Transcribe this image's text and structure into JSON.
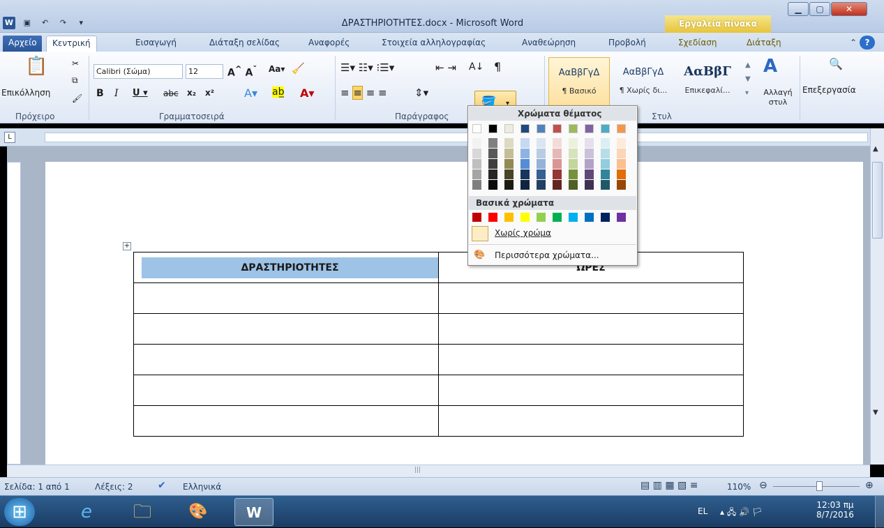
{
  "window": {
    "title": "ΔΡΑΣΤΗΡΙΟΤΗΤΕΣ.docx - Microsoft Word",
    "table_tools": "Εργαλεία πίνακα"
  },
  "tabs": [
    "Αρχείο",
    "Κεντρική",
    "Εισαγωγή",
    "Διάταξη σελίδας",
    "Αναφορές",
    "Στοιχεία αλληλογραφίας",
    "Αναθεώρηση",
    "Προβολή",
    "Σχεδίαση",
    "Διάταξη"
  ],
  "ribbon": {
    "paste_label": "Επικόλληση",
    "font_name": "Calibri (Σώμα)",
    "font_size": "12",
    "style1_sample": "ΑαΒβΓγΔ",
    "style1_label": "¶ Βασικό",
    "style2_sample": "ΑαΒβΓγΔ",
    "style2_label": "¶ Χωρίς δι...",
    "style3_sample": "ΑαΒβΓ",
    "style3_label": "Επικεφαλί...",
    "change_styles": "Αλλαγή στυλ",
    "editing": "Επεξεργασία",
    "groups": {
      "clipboard": "Πρόχειρο",
      "font": "Γραμματοσειρά",
      "paragraph": "Παράγραφος",
      "styles": "Στυλ"
    }
  },
  "popup": {
    "theme_colors": "Χρώματα θέματος",
    "standard_colors": "Βασικά χρώματα",
    "no_color": "Χωρίς χρώμα",
    "more_colors": "Περισσότερα χρώματα...",
    "theme_row": [
      "#ffffff",
      "#000000",
      "#eeece1",
      "#1f497d",
      "#4f81bd",
      "#c0504d",
      "#9bbb59",
      "#8064a2",
      "#4bacc6",
      "#f79646"
    ],
    "theme_shades": [
      [
        "#f2f2f2",
        "#7f7f7f",
        "#ddd9c3",
        "#c6d9f0",
        "#dbe5f1",
        "#f2dcdb",
        "#ebf1dd",
        "#e5e0ec",
        "#dbeef3",
        "#fdeada"
      ],
      [
        "#d8d8d8",
        "#595959",
        "#c4bd97",
        "#8db3e2",
        "#b8cce4",
        "#e5b9b7",
        "#d7e3bc",
        "#ccc1d9",
        "#b7dde8",
        "#fbd5b5"
      ],
      [
        "#bfbfbf",
        "#3f3f3f",
        "#938953",
        "#548dd4",
        "#95b3d7",
        "#d99694",
        "#c3d69b",
        "#b2a2c7",
        "#92cddc",
        "#fac08f"
      ],
      [
        "#a5a5a5",
        "#262626",
        "#494429",
        "#17365d",
        "#366092",
        "#953734",
        "#76923c",
        "#5f497a",
        "#31859b",
        "#e36c09"
      ],
      [
        "#7f7f7f",
        "#0c0c0c",
        "#1d1b10",
        "#0f243e",
        "#244061",
        "#632423",
        "#4f6128",
        "#3f3151",
        "#205867",
        "#974806"
      ]
    ],
    "standard_row": [
      "#c00000",
      "#ff0000",
      "#ffc000",
      "#ffff00",
      "#92d050",
      "#00b050",
      "#00b0f0",
      "#0070c0",
      "#002060",
      "#7030a0"
    ]
  },
  "table": {
    "headers": [
      "ΔΡΑΣΤΗΡΙΟΤΗΤΕΣ",
      "ΩΡΕΣ"
    ],
    "empty_rows": 5
  },
  "status": {
    "page": "Σελίδα: 1 από 1",
    "words": "Λέξεις: 2",
    "language": "Ελληνικά",
    "zoom": "110%"
  },
  "taskbar": {
    "lang": "EL",
    "time": "12:03 πμ",
    "date": "8/7/2016"
  }
}
